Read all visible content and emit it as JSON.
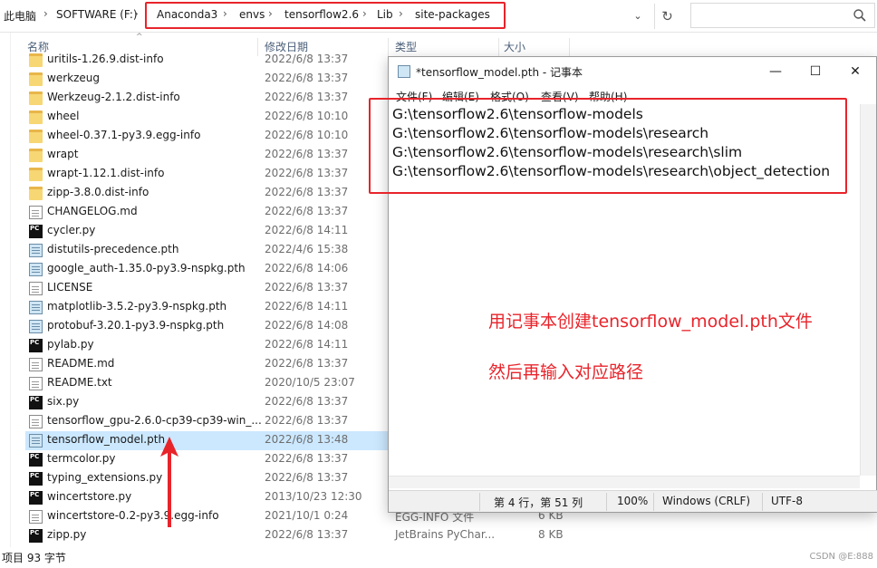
{
  "address_bar": {
    "crumbs_outside": [
      "此电脑",
      "SOFTWARE (F:)"
    ],
    "crumbs_inside": [
      "Anaconda3",
      "envs",
      "tensorflow2.6",
      "Lib",
      "site-packages"
    ],
    "separator": "›",
    "dropdown_glyph": "⌄",
    "refresh_glyph": "↻"
  },
  "columns": {
    "name": "名称",
    "date": "修改日期",
    "type": "类型",
    "size": "大小"
  },
  "files": [
    {
      "name": "uritils-1.26.9.dist-info",
      "date": "2022/6/8 13:37",
      "icon": "folder",
      "type": "",
      "size": ""
    },
    {
      "name": "werkzeug",
      "date": "2022/6/8 13:37",
      "icon": "folder",
      "type": "",
      "size": ""
    },
    {
      "name": "Werkzeug-2.1.2.dist-info",
      "date": "2022/6/8 13:37",
      "icon": "folder",
      "type": "",
      "size": ""
    },
    {
      "name": "wheel",
      "date": "2022/6/8 10:10",
      "icon": "folder",
      "type": "",
      "size": ""
    },
    {
      "name": "wheel-0.37.1-py3.9.egg-info",
      "date": "2022/6/8 10:10",
      "icon": "folder",
      "type": "",
      "size": ""
    },
    {
      "name": "wrapt",
      "date": "2022/6/8 13:37",
      "icon": "folder",
      "type": "",
      "size": ""
    },
    {
      "name": "wrapt-1.12.1.dist-info",
      "date": "2022/6/8 13:37",
      "icon": "folder",
      "type": "",
      "size": ""
    },
    {
      "name": "zipp-3.8.0.dist-info",
      "date": "2022/6/8 13:37",
      "icon": "folder",
      "type": "",
      "size": ""
    },
    {
      "name": "CHANGELOG.md",
      "date": "2022/6/8 13:37",
      "icon": "doc",
      "type": "",
      "size": ""
    },
    {
      "name": "cycler.py",
      "date": "2022/6/8 14:11",
      "icon": "py",
      "type": "",
      "size": ""
    },
    {
      "name": "distutils-precedence.pth",
      "date": "2022/4/6 15:38",
      "icon": "pth",
      "type": "",
      "size": ""
    },
    {
      "name": "google_auth-1.35.0-py3.9-nspkg.pth",
      "date": "2022/6/8 14:06",
      "icon": "pth",
      "type": "",
      "size": ""
    },
    {
      "name": "LICENSE",
      "date": "2022/6/8 13:37",
      "icon": "doc",
      "type": "",
      "size": ""
    },
    {
      "name": "matplotlib-3.5.2-py3.9-nspkg.pth",
      "date": "2022/6/8 14:11",
      "icon": "pth",
      "type": "",
      "size": ""
    },
    {
      "name": "protobuf-3.20.1-py3.9-nspkg.pth",
      "date": "2022/6/8 14:08",
      "icon": "pth",
      "type": "",
      "size": ""
    },
    {
      "name": "pylab.py",
      "date": "2022/6/8 14:11",
      "icon": "py",
      "type": "",
      "size": ""
    },
    {
      "name": "README.md",
      "date": "2022/6/8 13:37",
      "icon": "doc",
      "type": "",
      "size": ""
    },
    {
      "name": "README.txt",
      "date": "2020/10/5 23:07",
      "icon": "doc",
      "type": "",
      "size": ""
    },
    {
      "name": "six.py",
      "date": "2022/6/8 13:37",
      "icon": "py",
      "type": "",
      "size": ""
    },
    {
      "name": "tensorflow_gpu-2.6.0-cp39-cp39-win_...",
      "date": "2022/6/8 13:37",
      "icon": "doc",
      "type": "",
      "size": ""
    },
    {
      "name": "tensorflow_model.pth",
      "date": "2022/6/8 13:48",
      "icon": "pth",
      "type": "",
      "size": "",
      "selected": true
    },
    {
      "name": "termcolor.py",
      "date": "2022/6/8 13:37",
      "icon": "py",
      "type": "",
      "size": ""
    },
    {
      "name": "typing_extensions.py",
      "date": "2022/6/8 13:37",
      "icon": "py",
      "type": "",
      "size": ""
    },
    {
      "name": "wincertstore.py",
      "date": "2013/10/23 12:30",
      "icon": "py",
      "type": "",
      "size": ""
    },
    {
      "name": "wincertstore-0.2-py3.9.egg-info",
      "date": "2021/10/1 0:24",
      "icon": "doc",
      "type": "EGG-INFO 文件",
      "size": "6 KB"
    },
    {
      "name": "zipp.py",
      "date": "2022/6/8 13:37",
      "icon": "py",
      "type": "JetBrains PyChar...",
      "size": "8 KB"
    }
  ],
  "status_bar": {
    "text": "项目  93 字节",
    "watermark": "CSDN @E:888"
  },
  "notepad": {
    "title": "*tensorflow_model.pth - 记事本",
    "buttons": {
      "minimize": "—",
      "maximize": "☐",
      "close": "✕"
    },
    "menu": [
      "文件(F)",
      "编辑(E)",
      "格式(O)",
      "查看(V)",
      "帮助(H)"
    ],
    "lines": [
      "G:\\tensorflow2.6\\tensorflow-models",
      "G:\\tensorflow2.6\\tensorflow-models\\research",
      "G:\\tensorflow2.6\\tensorflow-models\\research\\slim",
      "G:\\tensorflow2.6\\tensorflow-models\\research\\object_detection"
    ],
    "status": {
      "position": "第 4 行，第 51 列",
      "zoom": "100%",
      "line_endings": "Windows (CRLF)",
      "encoding": "UTF-8"
    }
  },
  "annotations": {
    "line1": "用记事本创建tensorflow_model.pth文件",
    "line2": "然后再输入对应路径"
  },
  "colors": {
    "highlight_red": "#e8242b",
    "selection_blue": "#cce8ff",
    "header_text": "#4c607a"
  }
}
